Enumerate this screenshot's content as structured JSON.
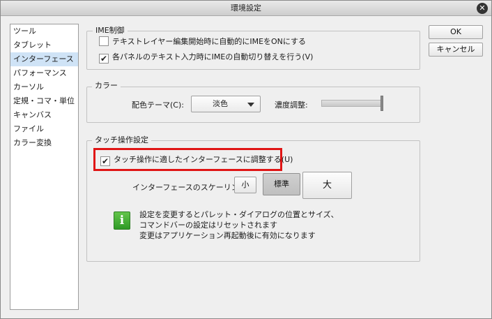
{
  "window": {
    "title": "環境設定"
  },
  "sidebar": {
    "items": [
      {
        "label": "ツール"
      },
      {
        "label": "タブレット"
      },
      {
        "label": "インターフェース",
        "selected": true
      },
      {
        "label": "パフォーマンス"
      },
      {
        "label": "カーソル"
      },
      {
        "label": "定規・コマ・単位"
      },
      {
        "label": "キャンバス"
      },
      {
        "label": "ファイル"
      },
      {
        "label": "カラー変換"
      }
    ]
  },
  "buttons": {
    "ok": "OK",
    "cancel": "キャンセル"
  },
  "ime_group": {
    "title": "IME制御",
    "option1": {
      "label": "テキストレイヤー編集開始時に自動的にIMEをONにする",
      "checked": false
    },
    "option2": {
      "label": "各パネルのテキスト入力時にIMEの自動切り替えを行う(V)",
      "checked": true
    }
  },
  "color_group": {
    "title": "カラー",
    "theme_label": "配色テーマ(C):",
    "theme_value": "淡色",
    "density_label": "濃度調整:",
    "density_level": 1.0
  },
  "touch_group": {
    "title": "タッチ操作設定",
    "touch_option": {
      "label": "タッチ操作に適したインターフェースに調整する(U)",
      "checked": true
    },
    "scaling_label": "インターフェースのスケーリング:",
    "scaling_options": {
      "small": "小",
      "standard": "標準",
      "large": "大"
    },
    "scaling_selected": "standard",
    "info_lines": [
      "設定を変更するとパレット・ダイアログの位置とサイズ、",
      "コマンドバーの設定はリセットされます",
      "変更はアプリケーション再起動後に有効になります"
    ]
  },
  "check_glyph": "✔",
  "close_glyph": "✕",
  "info_glyph": "i"
}
